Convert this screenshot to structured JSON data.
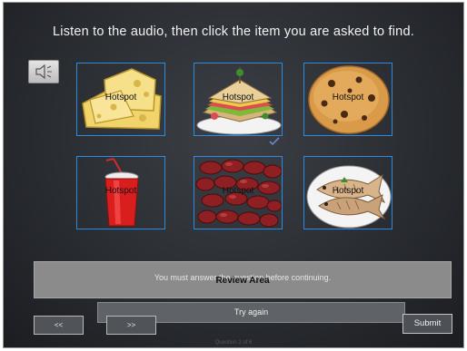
{
  "instruction": "Listen to the audio, then click the item you are asked to find.",
  "audio_button": {
    "icon": "speaker-icon"
  },
  "hotspots": [
    {
      "label": "Hotspot",
      "item": "cheese"
    },
    {
      "label": "Hotspot",
      "item": "sandwich",
      "checked": true
    },
    {
      "label": "Hotspot",
      "item": "cookie"
    },
    {
      "label": "Hotspot",
      "item": "soda cup"
    },
    {
      "label": "Hotspot",
      "item": "kidney beans"
    },
    {
      "label": "Hotspot",
      "item": "fish"
    }
  ],
  "review": {
    "message": "You must answer the question before continuing.",
    "label": "Review Area"
  },
  "buttons": {
    "try_again": "Try again",
    "prev": "<<",
    "next": ">>",
    "submit": "Submit"
  },
  "progress": "Question 2 of 6",
  "colors": {
    "hotspot_border": "#2b8be0",
    "background": "#2e3136"
  }
}
